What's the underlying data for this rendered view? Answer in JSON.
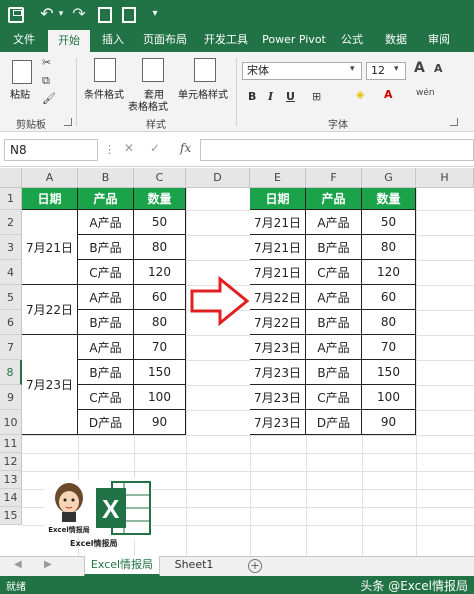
{
  "quick_access": {
    "undo_arrow": "▾",
    "more": "▾"
  },
  "tabs": [
    "文件",
    "开始",
    "插入",
    "页面布局",
    "开发工具",
    "Power Pivot",
    "公式",
    "数据",
    "审阅"
  ],
  "ribbon": {
    "clipboard": {
      "paste": "粘贴",
      "group": "剪贴板"
    },
    "styles": {
      "conditional": "条件格式",
      "table_line1": "套用",
      "table_line2": "表格格式",
      "cell_styles": "单元格样式",
      "group": "样式"
    },
    "font": {
      "name": "宋体",
      "size": "12",
      "bold": "B",
      "italic": "I",
      "underline": "U",
      "group": "字体",
      "wen": "wén"
    }
  },
  "formula_bar": {
    "name_box": "N8",
    "cancel": "✕",
    "enter": "✓",
    "fx": "fx",
    "value": ""
  },
  "columns": [
    "A",
    "B",
    "C",
    "D",
    "E",
    "F",
    "G",
    "H"
  ],
  "rows": [
    "1",
    "2",
    "3",
    "4",
    "5",
    "6",
    "7",
    "8",
    "9",
    "10",
    "11",
    "12",
    "13",
    "14",
    "15"
  ],
  "left_table": {
    "headers": [
      "日期",
      "产品",
      "数量"
    ],
    "groups": [
      {
        "date": "7月21日",
        "items": [
          [
            "A产品",
            "50"
          ],
          [
            "B产品",
            "80"
          ],
          [
            "C产品",
            "120"
          ]
        ]
      },
      {
        "date": "7月22日",
        "items": [
          [
            "A产品",
            "60"
          ],
          [
            "B产品",
            "80"
          ]
        ]
      },
      {
        "date": "7月23日",
        "items": [
          [
            "A产品",
            "70"
          ],
          [
            "B产品",
            "150"
          ],
          [
            "C产品",
            "100"
          ],
          [
            "D产品",
            "90"
          ]
        ]
      }
    ]
  },
  "right_table": {
    "headers": [
      "日期",
      "产品",
      "数量"
    ],
    "rows": [
      [
        "7月21日",
        "A产品",
        "50"
      ],
      [
        "7月21日",
        "B产品",
        "80"
      ],
      [
        "7月21日",
        "C产品",
        "120"
      ],
      [
        "7月22日",
        "A产品",
        "60"
      ],
      [
        "7月22日",
        "B产品",
        "80"
      ],
      [
        "7月23日",
        "A产品",
        "70"
      ],
      [
        "7月23日",
        "B产品",
        "150"
      ],
      [
        "7月23日",
        "C产品",
        "100"
      ],
      [
        "7月23日",
        "D产品",
        "90"
      ]
    ]
  },
  "logos": {
    "logo1_text": "Excel情报局",
    "logo1_caption": "Excel情报局",
    "logo2_letter": "X"
  },
  "sheets": [
    {
      "name": "Excel情报局",
      "active": true
    },
    {
      "name": "Sheet1",
      "active": false
    }
  ],
  "sheet_nav": {
    "prev": "◀",
    "next": "▶",
    "add": "+"
  },
  "status": {
    "ready": "就绪"
  },
  "watermark": "头条 @Excel情报局",
  "colors": {
    "excel_green": "#217346",
    "header_green": "#1aa34a",
    "arrow_red": "#e02020"
  }
}
